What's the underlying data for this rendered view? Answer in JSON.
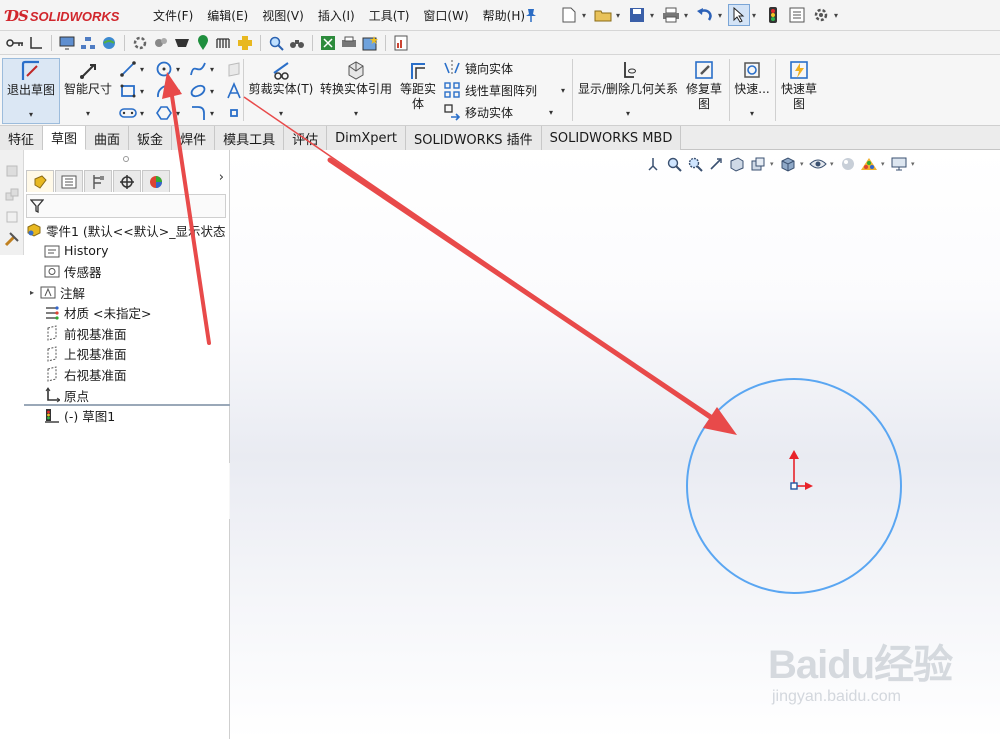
{
  "app": {
    "brand": "SOLIDWORKS",
    "brand_color": "#d1262c"
  },
  "menu": {
    "items": [
      "文件(F)",
      "编辑(E)",
      "视图(V)",
      "插入(I)",
      "工具(T)",
      "窗口(W)",
      "帮助(H)"
    ]
  },
  "ribbon": {
    "exit_sketch": "退出草图",
    "smart_dimension": "智能尺寸",
    "trim_entities": "剪裁实体(T)",
    "convert_entities": "转换实体引用",
    "offset_entities": [
      "等距实",
      "体"
    ],
    "mirror_entities": "镜向实体",
    "linear_pattern": "线性草图阵列",
    "move_entities": "移动实体",
    "display_delete_relations": "显示/删除几何关系",
    "repair_sketch": [
      "修复草",
      "图"
    ],
    "quick_snaps": "快速...",
    "rapid_sketch": [
      "快速草",
      "图"
    ]
  },
  "tabs": [
    {
      "label": "特征",
      "active": false
    },
    {
      "label": "草图",
      "active": true
    },
    {
      "label": "曲面",
      "active": false
    },
    {
      "label": "钣金",
      "active": false
    },
    {
      "label": "焊件",
      "active": false
    },
    {
      "label": "模具工具",
      "active": false
    },
    {
      "label": "评估",
      "active": false
    },
    {
      "label": "DimXpert",
      "active": false
    },
    {
      "label": "SOLIDWORKS 插件",
      "active": false
    },
    {
      "label": "SOLIDWORKS MBD",
      "active": false
    }
  ],
  "feature_tree": {
    "part": "零件1 (默认<<默认>_显示状态",
    "items": [
      {
        "label": "History",
        "icon": "history-folder-icon"
      },
      {
        "label": "传感器",
        "icon": "sensor-folder-icon"
      },
      {
        "label": "注解",
        "icon": "annotations-icon"
      },
      {
        "label": "材质 <未指定>",
        "icon": "material-icon"
      },
      {
        "label": "前视基准面",
        "icon": "plane-icon"
      },
      {
        "label": "上视基准面",
        "icon": "plane-icon"
      },
      {
        "label": "右视基准面",
        "icon": "plane-icon"
      },
      {
        "label": "原点",
        "icon": "origin-icon"
      }
    ],
    "active_sketch": "(-) 草图1"
  },
  "graphics": {
    "sketch_circle_color": "#5aa6f2",
    "origin_x_color": "#e8232a",
    "origin_y_color": "#e8232a",
    "annotation_arrow_color": "#e84a4a"
  },
  "watermark": {
    "main": "Baidu经验",
    "sub": "jingyan.baidu.com"
  }
}
